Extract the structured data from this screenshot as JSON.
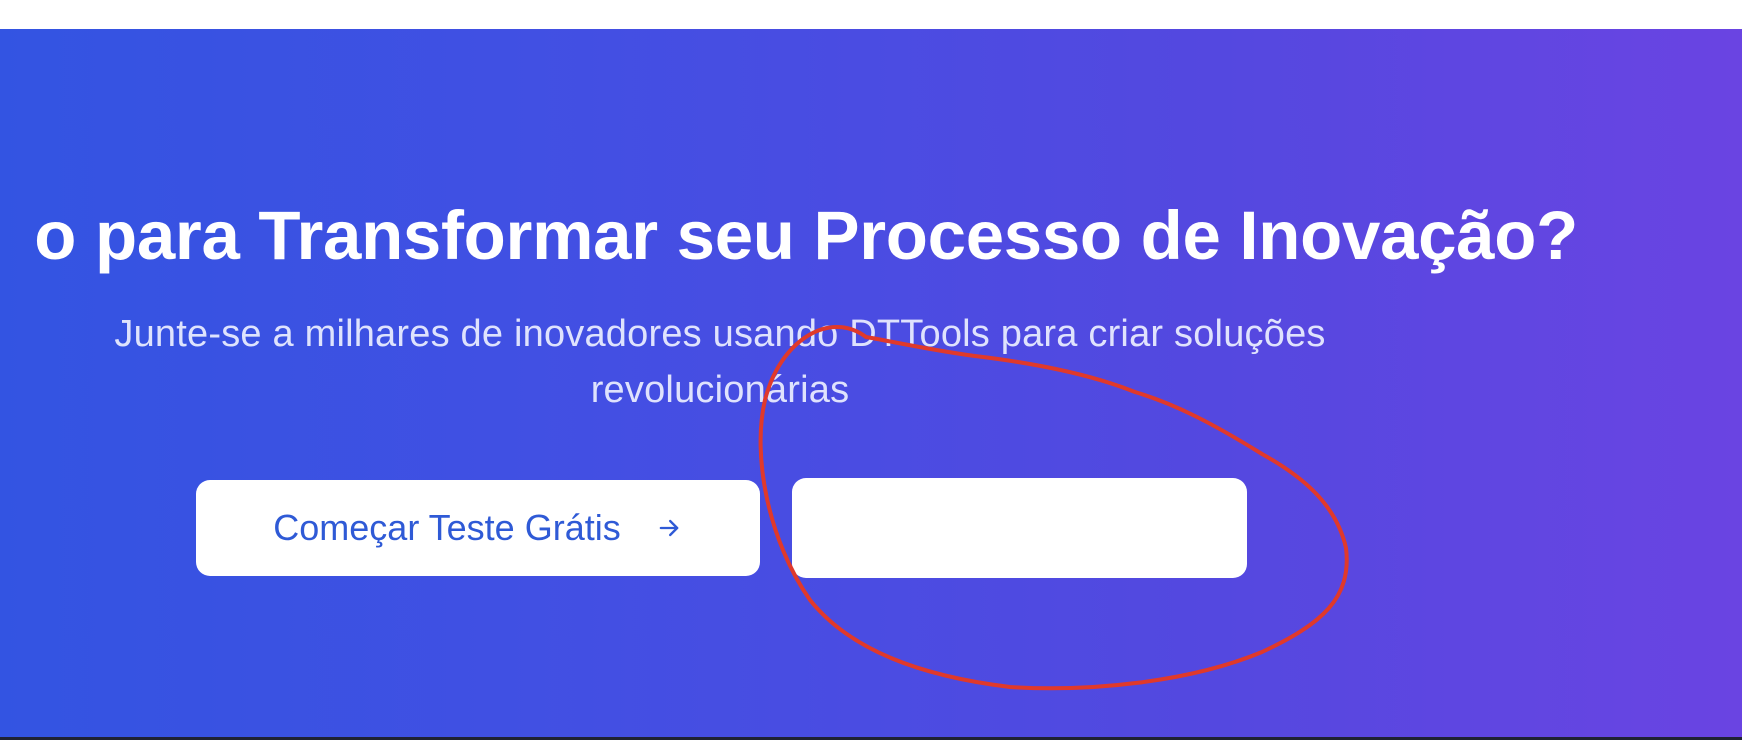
{
  "cta": {
    "headline": "o para Transformar seu Processo de Inovação?",
    "subtitle": "Junte-se a milhares de inovadores usando DTTools para criar soluções revolucionárias",
    "primary_button_label": "Começar Teste Grátis",
    "primary_button_icon": "arrow-right-icon",
    "secondary_button_label": ""
  },
  "colors": {
    "gradient_start": "#3354e2",
    "gradient_end": "#6a44e2",
    "button_text": "#2f5ad6",
    "annotation_stroke": "#e0392b"
  }
}
